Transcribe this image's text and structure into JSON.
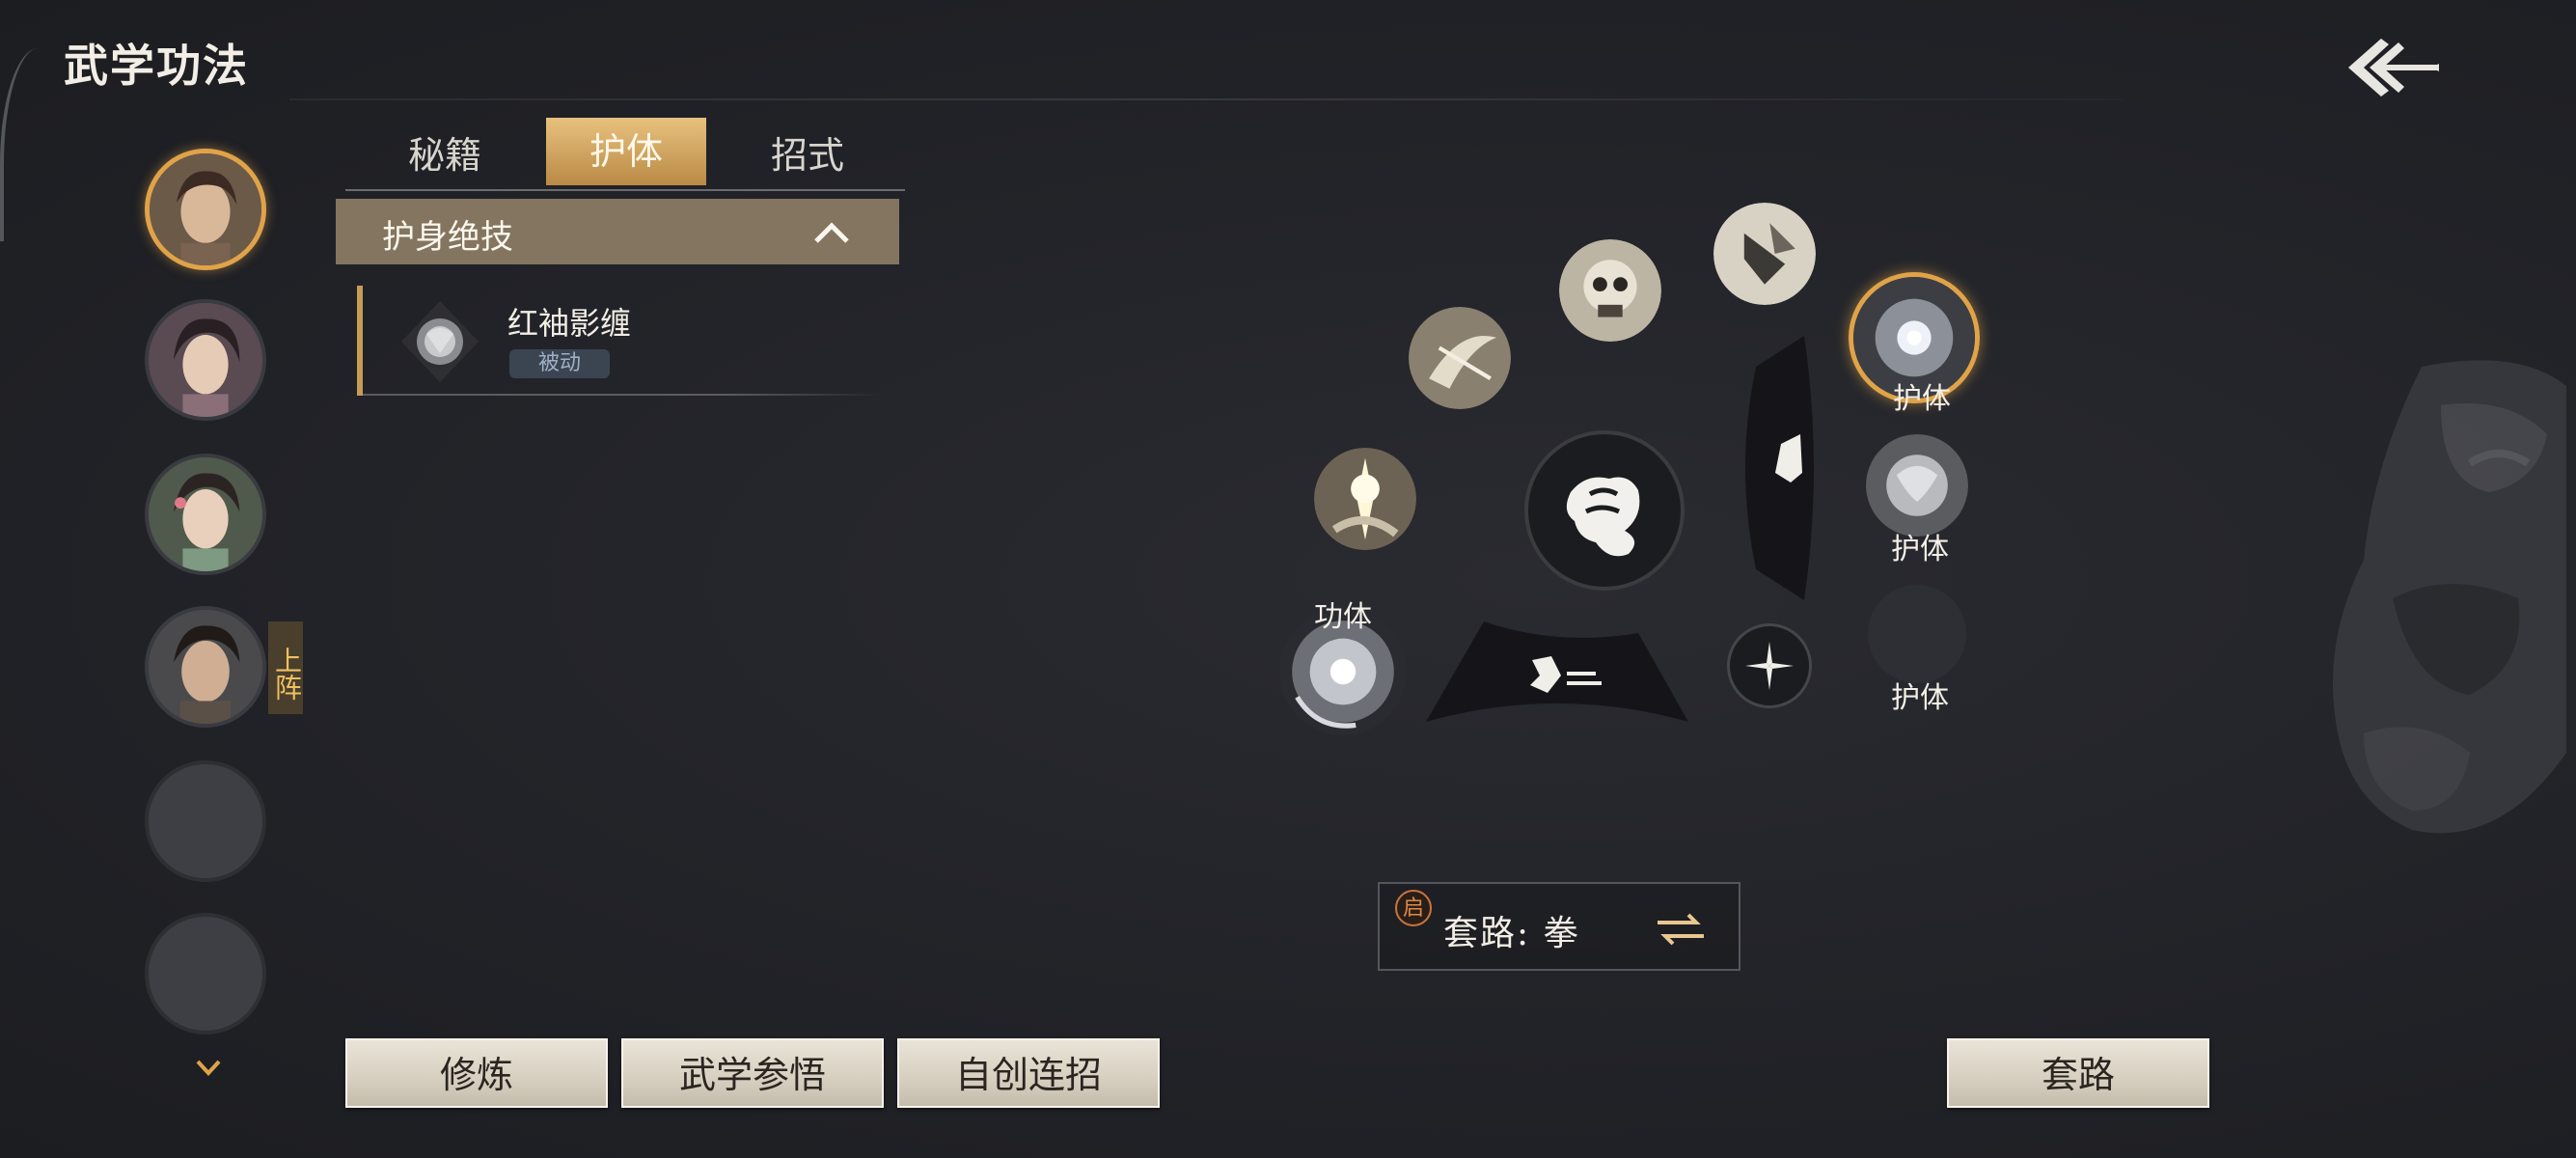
{
  "header": {
    "title": "武学功法"
  },
  "characters": {
    "deploy_tag": "上阵",
    "avatars": [
      {
        "name": "char-1",
        "selected": true
      },
      {
        "name": "char-2"
      },
      {
        "name": "char-3"
      },
      {
        "name": "char-4",
        "deployed": true
      },
      {
        "name": "empty-1"
      },
      {
        "name": "empty-2"
      }
    ]
  },
  "tabs": [
    {
      "label": "秘籍",
      "active": false
    },
    {
      "label": "护体",
      "active": true
    },
    {
      "label": "招式",
      "active": false
    }
  ],
  "category": {
    "label": "护身绝技",
    "expanded": true
  },
  "skill": {
    "name": "红袖影缠",
    "tag": "被动"
  },
  "wheel": {
    "labels": {
      "gongti": "功体",
      "huti_1": "护体",
      "huti_2": "护体",
      "huti_3": "护体"
    }
  },
  "routine": {
    "badge": "启",
    "label": "套路: 拳"
  },
  "buttons": {
    "practice": "修炼",
    "insight": "武学参悟",
    "combo": "自创连招",
    "routine": "套路"
  },
  "colors": {
    "accent": "#e0a348",
    "tab_active": "#d4a661",
    "category_bar": "#847560"
  }
}
